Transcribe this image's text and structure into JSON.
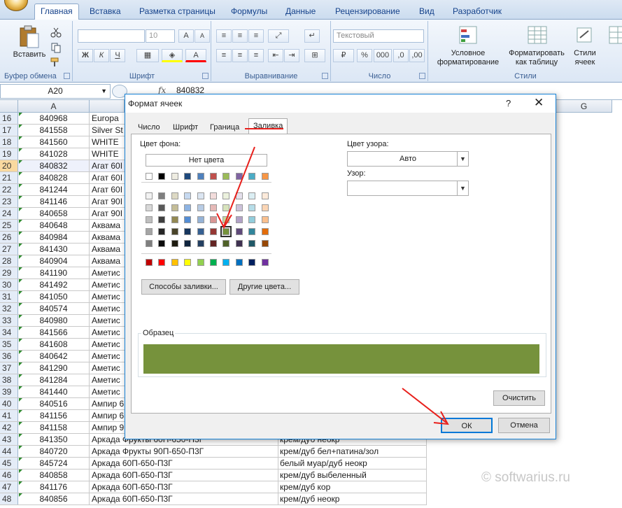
{
  "ribbon": {
    "tabs": [
      "Главная",
      "Вставка",
      "Разметка страницы",
      "Формулы",
      "Данные",
      "Рецензирование",
      "Вид",
      "Разработчик"
    ],
    "clipboard": {
      "paste": "Вставить",
      "label": "Буфер обмена"
    },
    "font": {
      "size": "10",
      "bold": "Ж",
      "italic": "К",
      "underline": "Ч",
      "label": "Шрифт"
    },
    "alignment": {
      "label": "Выравнивание"
    },
    "number": {
      "format": "Текстовый",
      "percent": "%",
      "thousands": "000",
      "label": "Число"
    },
    "styles": {
      "conditional": "Условное форматирование",
      "as_table": "Форматировать как таблицу",
      "cell_styles": "Стили ячеек",
      "label": "Стили"
    }
  },
  "formula_bar": {
    "name_box": "A20",
    "fx": "fx",
    "value": "840832"
  },
  "grid": {
    "columns": [
      "A",
      "G"
    ],
    "rows": [
      {
        "n": "16",
        "a": "840968",
        "b": "Europa",
        "c": ""
      },
      {
        "n": "17",
        "a": "841558",
        "b": "Silver St",
        "c": ""
      },
      {
        "n": "18",
        "a": "841560",
        "b": "WHITE",
        "c": ""
      },
      {
        "n": "19",
        "a": "841028",
        "b": "WHITE",
        "c": ""
      },
      {
        "n": "20",
        "a": "840832",
        "b": "Агат 60I",
        "c": ""
      },
      {
        "n": "21",
        "a": "840828",
        "b": "Агат 60I",
        "c": ""
      },
      {
        "n": "22",
        "a": "841244",
        "b": "Агат 60I",
        "c": ""
      },
      {
        "n": "23",
        "a": "841146",
        "b": "Агат 90I",
        "c": ""
      },
      {
        "n": "24",
        "a": "840658",
        "b": "Агат 90I",
        "c": ""
      },
      {
        "n": "25",
        "a": "840648",
        "b": "Аквама",
        "c": ""
      },
      {
        "n": "26",
        "a": "840984",
        "b": "Аквама",
        "c": ""
      },
      {
        "n": "27",
        "a": "841430",
        "b": "Аквама",
        "c": ""
      },
      {
        "n": "28",
        "a": "840904",
        "b": "Аквама",
        "c": ""
      },
      {
        "n": "29",
        "a": "841190",
        "b": "Аметис",
        "c": ""
      },
      {
        "n": "30",
        "a": "841492",
        "b": "Аметис",
        "c": ""
      },
      {
        "n": "31",
        "a": "841050",
        "b": "Аметис",
        "c": ""
      },
      {
        "n": "32",
        "a": "840574",
        "b": "Аметис",
        "c": ""
      },
      {
        "n": "33",
        "a": "840980",
        "b": "Аметис",
        "c": ""
      },
      {
        "n": "34",
        "a": "841566",
        "b": "Аметис",
        "c": ""
      },
      {
        "n": "35",
        "a": "841608",
        "b": "Аметис",
        "c": ""
      },
      {
        "n": "36",
        "a": "840642",
        "b": "Аметис",
        "c": ""
      },
      {
        "n": "37",
        "a": "841290",
        "b": "Аметис",
        "c": ""
      },
      {
        "n": "38",
        "a": "841284",
        "b": "Аметис",
        "c": ""
      },
      {
        "n": "39",
        "a": "841440",
        "b": "Аметис",
        "c": ""
      },
      {
        "n": "40",
        "a": "840516",
        "b": "Ампир 6",
        "c": ""
      },
      {
        "n": "41",
        "a": "841156",
        "b": "Ампир 6",
        "c": ""
      },
      {
        "n": "42",
        "a": "841158",
        "b": "Ампир 9",
        "c": ""
      },
      {
        "n": "43",
        "a": "841350",
        "b": "Аркада Фрукты 60П-650-П3Г",
        "c": "крем/дуб неокр"
      },
      {
        "n": "44",
        "a": "840720",
        "b": "Аркада Фрукты 90П-650-П3Г",
        "c": "крем/дуб бел+патина/зол"
      },
      {
        "n": "45",
        "a": "845724",
        "b": "Аркада 60П-650-П3Г",
        "c": "белый муар/дуб неокр"
      },
      {
        "n": "46",
        "a": "840858",
        "b": "Аркада 60П-650-П3Г",
        "c": "крем/дуб выбеленный"
      },
      {
        "n": "47",
        "a": "841176",
        "b": "Аркада 60П-650-П3Г",
        "c": "крем/дуб кор"
      },
      {
        "n": "48",
        "a": "840856",
        "b": "Аркада 60П-650-П3Г",
        "c": "крем/дуб неокр"
      }
    ]
  },
  "watermark": "© softwarius.ru",
  "dialog": {
    "title": "Формат ячеек",
    "help": "?",
    "close": "✕",
    "tabs": [
      "Число",
      "Шрифт",
      "Граница",
      "Заливка"
    ],
    "active_tab": "Заливка",
    "bg_color_label": "Цвет фона:",
    "no_color": "Нет цвета",
    "pattern_color_label": "Цвет узора:",
    "pattern_color_value": "Авто",
    "pattern_label": "Узор:",
    "fill_effects": "Способы заливки...",
    "more_colors": "Другие цвета...",
    "sample_label": "Образец",
    "sample_color": "#76923c",
    "clear": "Очистить",
    "ok": "ОК",
    "cancel": "Отмена",
    "palette_theme_top": [
      "#ffffff",
      "#000000",
      "#eeece1",
      "#1f497d",
      "#4f81bd",
      "#c0504d",
      "#9bbb59",
      "#8064a2",
      "#4bacc6",
      "#f79646"
    ],
    "palette_shades": [
      [
        "#f2f2f2",
        "#7f7f7f",
        "#ddd9c3",
        "#c6d9f0",
        "#dbe5f1",
        "#f2dcdb",
        "#ebf1dd",
        "#e5e0ec",
        "#dbeef3",
        "#fdeada"
      ],
      [
        "#d8d8d8",
        "#595959",
        "#c4bd97",
        "#8db3e2",
        "#b8cce4",
        "#e5b9b7",
        "#d7e3bc",
        "#ccc1d9",
        "#b7dde8",
        "#fbd5b5"
      ],
      [
        "#bfbfbf",
        "#3f3f3f",
        "#938953",
        "#548dd4",
        "#95b3d7",
        "#d99694",
        "#c3d69b",
        "#b2a2c7",
        "#92cddc",
        "#fac08f"
      ],
      [
        "#a5a5a5",
        "#262626",
        "#494429",
        "#17365d",
        "#366092",
        "#953734",
        "#76923c",
        "#5f497a",
        "#31859b",
        "#e36c09"
      ],
      [
        "#7f7f7f",
        "#0c0c0c",
        "#1d1b10",
        "#0f243e",
        "#244061",
        "#632423",
        "#4f6128",
        "#3f3151",
        "#205867",
        "#974806"
      ]
    ],
    "palette_standard": [
      "#c00000",
      "#ff0000",
      "#ffc000",
      "#ffff00",
      "#92d050",
      "#00b050",
      "#00b0f0",
      "#0070c0",
      "#002060",
      "#7030a0"
    ],
    "annotation_color": "#e8201c"
  }
}
